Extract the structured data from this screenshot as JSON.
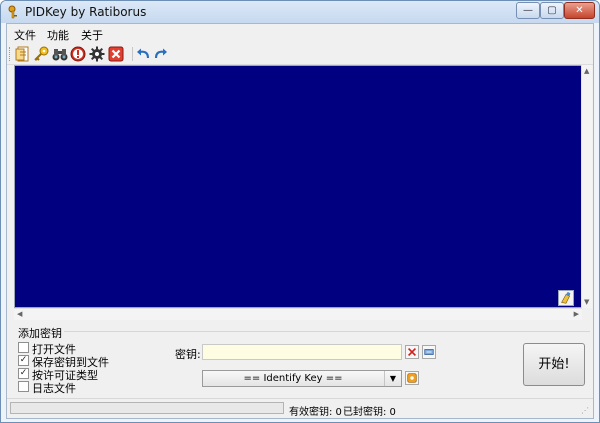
{
  "window": {
    "title": "PIDKey by Ratiborus",
    "controls": {
      "minimize": "—",
      "maximize": "▢",
      "close": "✕"
    }
  },
  "menu": {
    "items": [
      {
        "label": "文件"
      },
      {
        "label": "功能"
      },
      {
        "label": "关于"
      }
    ]
  },
  "toolbar": {
    "icons": [
      "document-icon",
      "key-icon",
      "binoculars-icon",
      "stop-icon",
      "gear-icon",
      "close-icon",
      "undo-icon",
      "redo-icon"
    ]
  },
  "output": {
    "background_color": "#000080"
  },
  "add_key_group": {
    "label": "添加密钥",
    "options": [
      {
        "label": "打开文件",
        "checked": false
      },
      {
        "label": "保存密钥到文件",
        "checked": true
      },
      {
        "label": "按许可证类型",
        "checked": true
      },
      {
        "label": "日志文件",
        "checked": false
      }
    ]
  },
  "key": {
    "label": "密钥:",
    "value": ""
  },
  "identify": {
    "selected": "== Identify Key =="
  },
  "start_button": {
    "label": "开始!"
  },
  "status": {
    "progress": 0,
    "valid_keys": "有效密钥: 0",
    "blocked_keys": "已封密钥: 0"
  }
}
